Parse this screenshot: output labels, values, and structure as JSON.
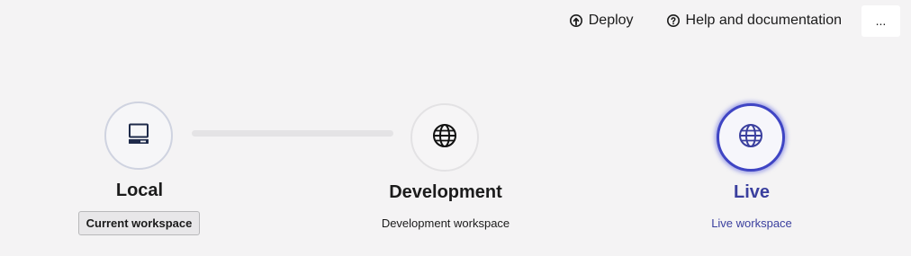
{
  "toolbar": {
    "deploy_label": "Deploy",
    "deploy_icon": "deploy-icon",
    "help_label": "Help and documentation",
    "help_icon": "help-icon",
    "more_label": "..."
  },
  "workspaces": [
    {
      "title": "Local",
      "subtitle": "Current workspace",
      "icon": "computer-icon",
      "state": "current"
    },
    {
      "title": "Development",
      "subtitle": "Development workspace",
      "icon": "globe-icon",
      "state": "default"
    },
    {
      "title": "Live",
      "subtitle": "Live workspace",
      "icon": "globe-icon",
      "state": "selected"
    }
  ],
  "colors": {
    "background": "#f4f3f4",
    "accent": "#3f45c4",
    "live_text": "#3a3f9e",
    "connector": "#e4e3e5"
  }
}
